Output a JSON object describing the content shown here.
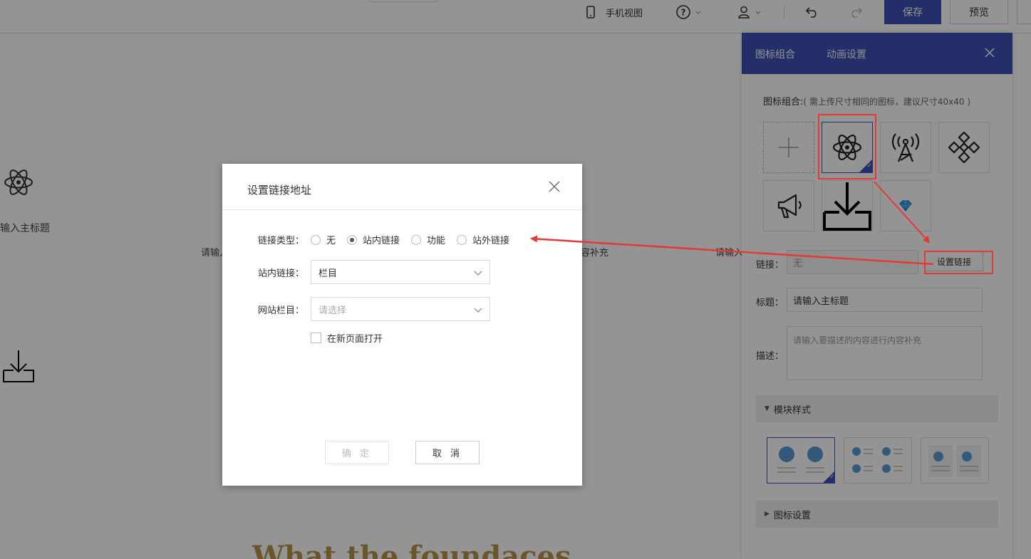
{
  "topbar": {
    "mobile_view": "手机视图",
    "help": "?",
    "save": "保存",
    "preview": "预览"
  },
  "canvas": {
    "title_text": "输入主标题",
    "desc_left": "请输入",
    "desc_mid": "容补充",
    "desc_right": "请输入",
    "big_heading": "What the foundaces"
  },
  "panel": {
    "tabs": [
      "图标组合",
      "动画设置"
    ],
    "icon_group_label": "图标组合:",
    "icon_group_hint": "( 需上传尺寸相同的图标，建议尺寸40x40 )",
    "link_label": "链接：",
    "link_value": "无",
    "set_link_button": "设置链接",
    "title_label": "标题：",
    "title_value": "请输入主标题",
    "desc_label": "描述：",
    "desc_placeholder": "请输入要描述的内容进行内容补充",
    "module_style": "模块样式",
    "icon_settings": "图标设置"
  },
  "dialog": {
    "title": "设置链接地址",
    "link_type_label": "链接类型：",
    "link_types": [
      "无",
      "站内链接",
      "功能",
      "站外链接"
    ],
    "link_type_selected": "站内链接",
    "internal_link_label": "站内链接：",
    "internal_link_value": "栏目",
    "site_column_label": "网站栏目：",
    "site_column_placeholder": "请选择",
    "open_new_page": "在新页面打开",
    "confirm": "确 定",
    "cancel": "取 消"
  },
  "colors": {
    "primary": "#3f51b5",
    "annotation": "#e53935",
    "heading_gold": "#b8954a"
  }
}
